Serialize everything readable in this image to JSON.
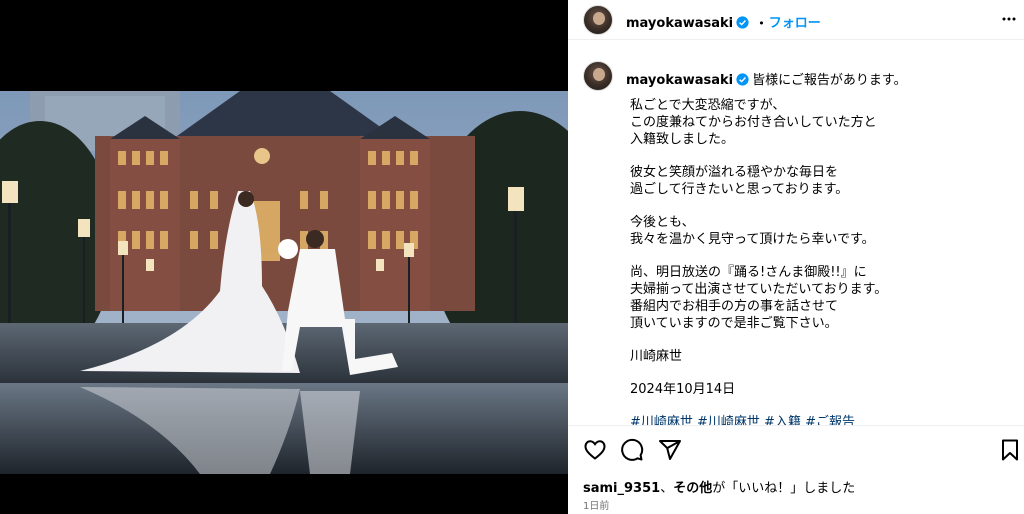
{
  "post": {
    "username": "mayokawasaki",
    "header_separator": "•",
    "follow_label": "フォロー",
    "caption_intro": "皆様にご報告があります。",
    "caption_paragraphs": [
      [
        "私ごとで大変恐縮ですが、",
        "この度兼ねてからお付き合いしていた方と",
        "入籍致しました。"
      ],
      [
        "彼女と笑顔が溢れる穏やかな毎日を",
        "過ごして行きたいと思っております。"
      ],
      [
        "今後とも、",
        "我々を温かく見守って頂けたら幸いです。"
      ],
      [
        "尚、明日放送の『踊る!さんま御殿!!』に",
        "夫婦揃って出演させていただいております。",
        "番組内でお相手の方の事を話させて",
        "頂いていますので是非ご覧下さい。"
      ],
      [
        "川崎麻世"
      ],
      [
        "2024年10月14日"
      ]
    ],
    "hashtags": "#川崎麻世 #川崎麻世 #入籍 #ご報告",
    "likes_user": "sami_9351",
    "likes_separator": "、",
    "likes_others": "その他",
    "likes_suffix": "が「いいね！」しました",
    "time_ago": "1日前"
  },
  "icons": {
    "verified": "verified-badge-icon",
    "more": "more-options-icon",
    "like": "heart-icon",
    "comment": "comment-icon",
    "share": "share-icon",
    "save": "bookmark-icon"
  },
  "colors": {
    "follow": "#0095f6",
    "verified": "#0095f6",
    "hashtag": "#00376b",
    "muted": "#737373"
  }
}
